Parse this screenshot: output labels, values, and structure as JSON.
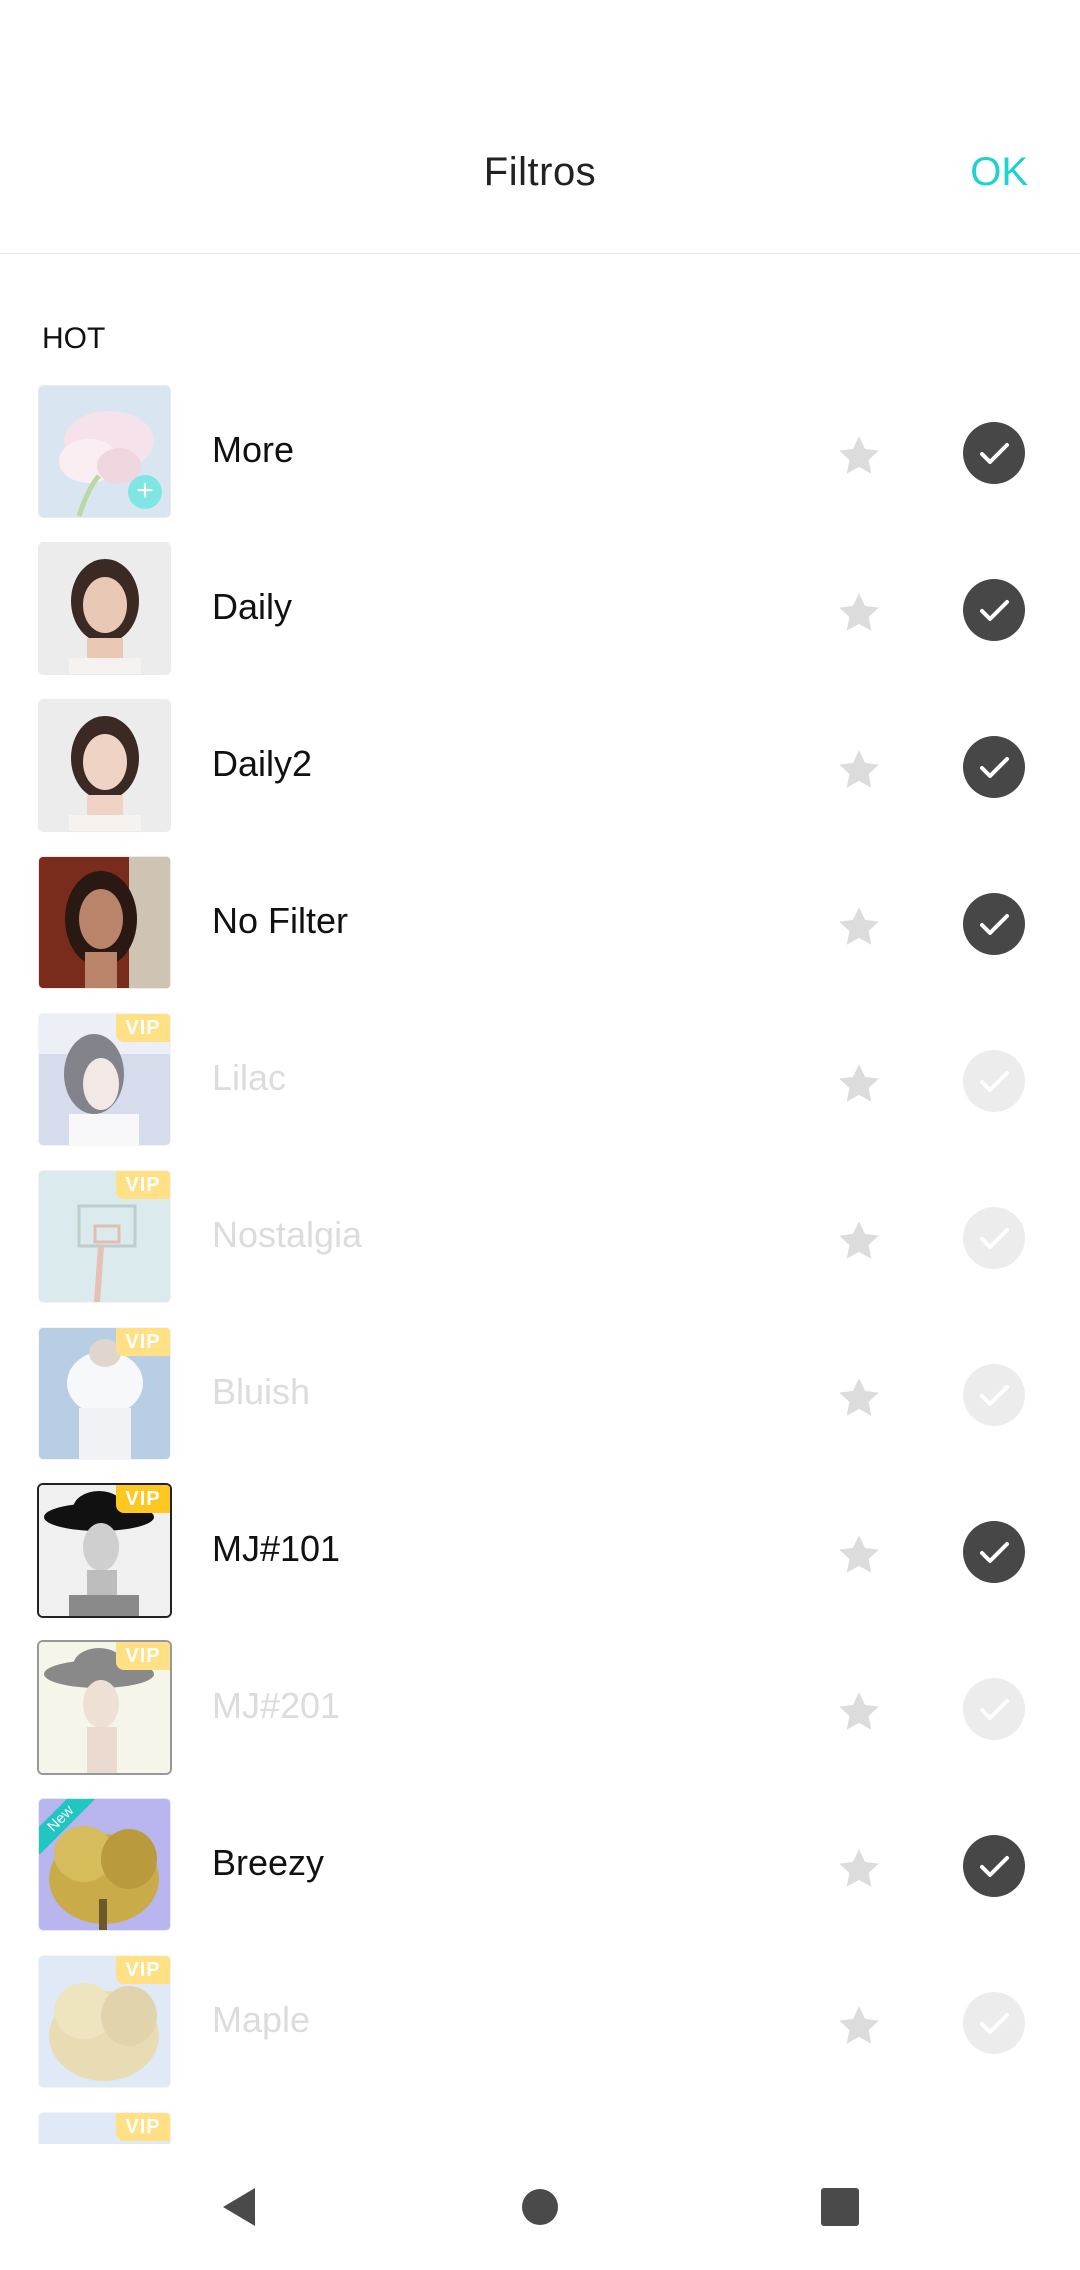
{
  "header": {
    "title": "Filtros",
    "ok_label": "OK"
  },
  "section": {
    "label": "HOT"
  },
  "filters": [
    {
      "name": "More",
      "enabled": false,
      "badge": "add"
    },
    {
      "name": "Daily",
      "enabled": true,
      "badge": ""
    },
    {
      "name": "Daily2",
      "enabled": true,
      "badge": ""
    },
    {
      "name": "No Filter",
      "enabled": true,
      "badge": ""
    },
    {
      "name": "Lilac",
      "enabled": false,
      "badge": "VIP"
    },
    {
      "name": "Nostalgia",
      "enabled": false,
      "badge": "VIP"
    },
    {
      "name": "Bluish",
      "enabled": false,
      "badge": "VIP"
    },
    {
      "name": "MJ#101",
      "enabled": true,
      "badge": "VIP"
    },
    {
      "name": "MJ#201",
      "enabled": false,
      "badge": "VIP"
    },
    {
      "name": "Breezy",
      "enabled": true,
      "badge": "New"
    },
    {
      "name": "Maple",
      "enabled": false,
      "badge": "VIP"
    },
    {
      "name": "",
      "enabled": false,
      "badge": "VIP"
    }
  ],
  "colors": {
    "accent": "#1fd1cf",
    "vip": "#ffc821",
    "new": "#20c6c2",
    "check_on": "#474747",
    "check_off": "#ececec"
  },
  "icons": {
    "star": "star-icon",
    "check": "check-icon",
    "back": "back-triangle-icon",
    "home": "home-circle-icon",
    "recents": "recents-square-icon"
  }
}
